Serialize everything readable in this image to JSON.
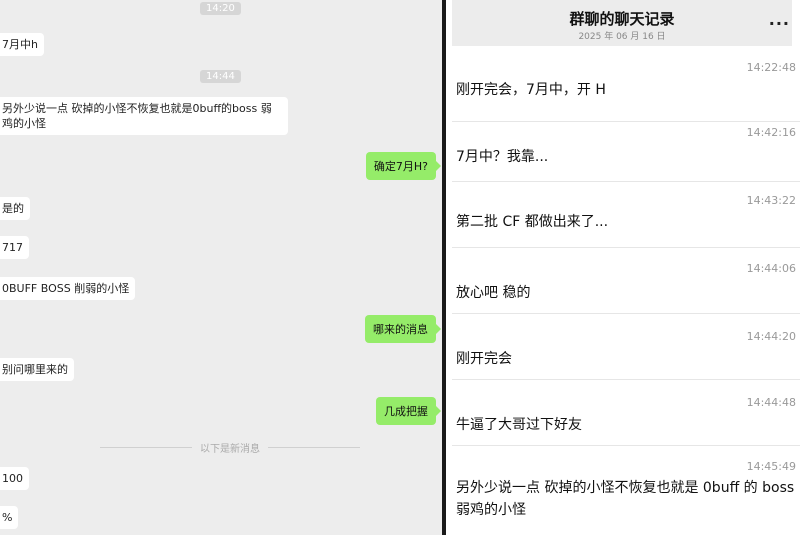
{
  "left_chat": {
    "timestamps": [
      "14:20",
      "14:44"
    ],
    "incoming": [
      {
        "text": "7月中h"
      },
      {
        "text": "另外少说一点 砍掉的小怪不恢复也就是0buff的boss 弱鸡的小怪"
      },
      {
        "text": "是的"
      },
      {
        "text": "717"
      },
      {
        "text": "0BUFF BOSS 削弱的小怪"
      },
      {
        "text": "别问哪里来的"
      },
      {
        "text": "100"
      },
      {
        "text": "%"
      }
    ],
    "outgoing": [
      {
        "text": "确定7月H?"
      },
      {
        "text": "哪来的消息"
      },
      {
        "text": "几成把握"
      }
    ],
    "new_messages_divider": "以下是新消息"
  },
  "right_panel": {
    "title": "群聊的聊天记录",
    "date": "2025 年 06 月 16 日",
    "more_icon": "...",
    "messages": [
      {
        "time": "14:22:48",
        "text": "刚开完会，7月中，开 H"
      },
      {
        "time": "14:42:16",
        "text": "7月中？我靠..."
      },
      {
        "time": "14:43:22",
        "text": "第二批 CF 都做出来了..."
      },
      {
        "time": "14:44:06",
        "text": "放心吧 稳的"
      },
      {
        "time": "14:44:20",
        "text": "刚开完会"
      },
      {
        "time": "14:44:48",
        "text": "牛逼了大哥过下好友"
      },
      {
        "time": "14:45:49",
        "text": "另外少说一点 砍掉的小怪不恢复也就是 0buff 的 boss 弱鸡的小怪"
      }
    ]
  },
  "colors": {
    "outgoing_bubble": "#95ec69",
    "chat_background": "#ededed"
  }
}
